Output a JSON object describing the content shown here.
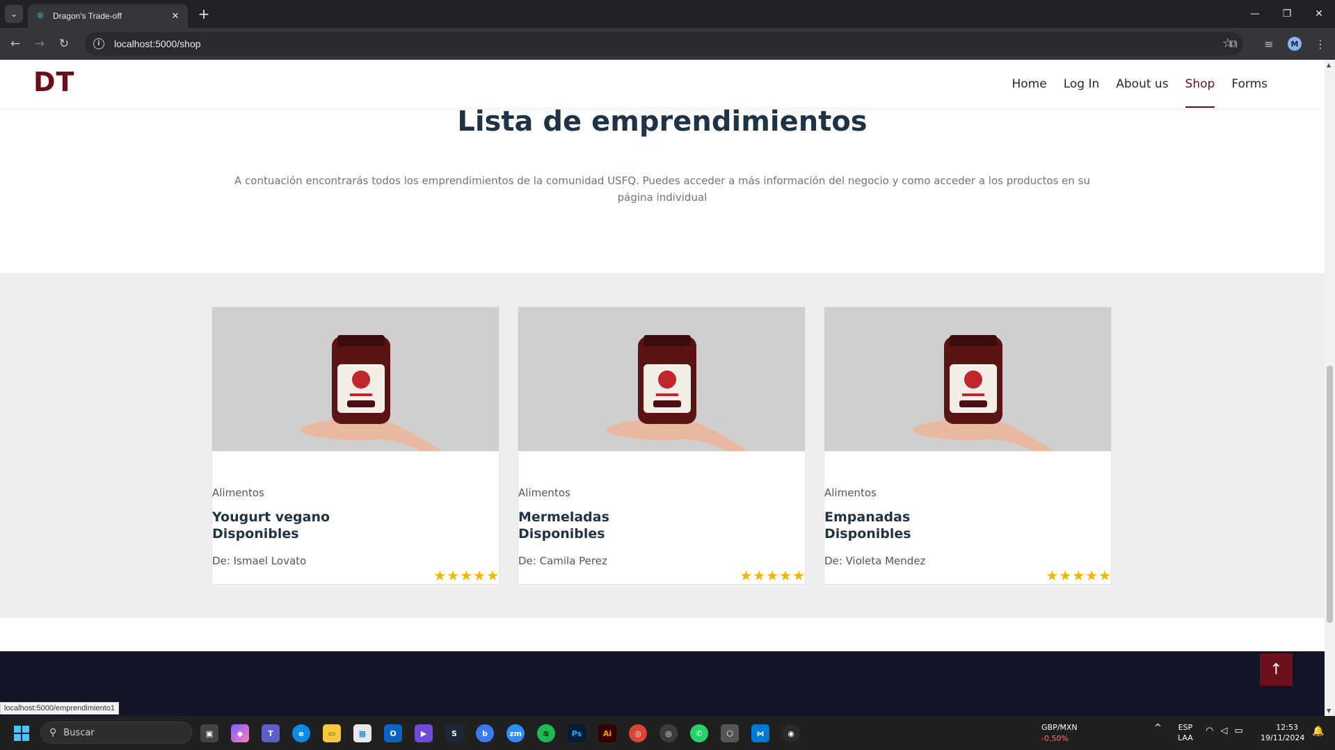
{
  "browser": {
    "tab_title": "Dragon's Trade-off",
    "url": "localhost:5000/shop",
    "profile_initial": "M",
    "status_url": "localhost:5000/emprendimiento1"
  },
  "site": {
    "logo": "DT",
    "nav": [
      {
        "label": "Home"
      },
      {
        "label": "Log In"
      },
      {
        "label": "About us"
      },
      {
        "label": "Shop",
        "active": true
      },
      {
        "label": "Forms"
      }
    ],
    "title": "Lista de emprendimientos",
    "subtitle": "A contuación encontrarás todos los emprendimientos de la comunidad USFQ. Puedes acceder a más información del negocio y como acceder a los productos en su página individual",
    "accent_color": "#6b0f1a",
    "footer_color": "#141427"
  },
  "cards": [
    {
      "category": "Alimentos",
      "title_line1": "Yougurt vegano",
      "title_line2": "Disponibles",
      "owner": "De: Ismael Lovato",
      "rating": 5,
      "image": "jar-in-hand-photo"
    },
    {
      "category": "Alimentos",
      "title_line1": "Mermeladas",
      "title_line2": "Disponibles",
      "owner": "De: Camila Perez",
      "rating": 5,
      "image": "jar-in-hand-photo"
    },
    {
      "category": "Alimentos",
      "title_line1": "Empanadas",
      "title_line2": "Disponibles",
      "owner": "De: Violeta Mendez",
      "rating": 5,
      "image": "jar-in-hand-photo"
    }
  ],
  "taskbar": {
    "search_placeholder": "Buscar",
    "ticker_pair": "GBP/MXN",
    "ticker_change": "-0.50%",
    "lang_line1": "ESP",
    "lang_line2": "LAA",
    "time": "12:53",
    "date": "19/11/2024"
  }
}
